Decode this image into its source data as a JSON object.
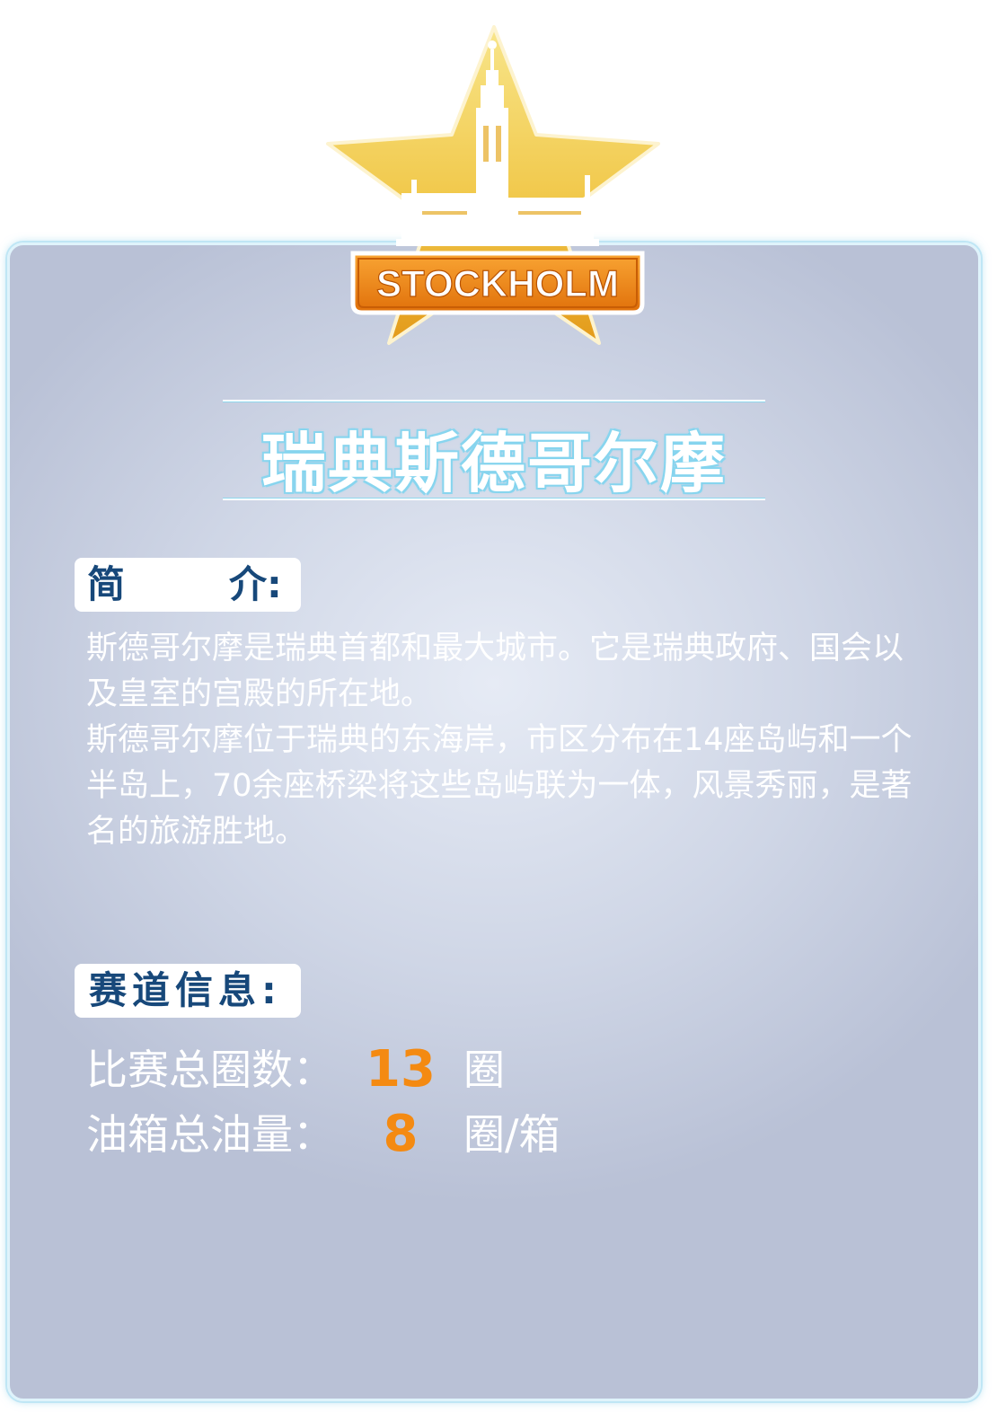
{
  "emblem": {
    "banner_text": "STOCKHOLM",
    "icon": "city-hall-star-icon",
    "colors": {
      "star_top": "#f7e07a",
      "star_bottom": "#e6a51e",
      "banner": "#f08a12"
    }
  },
  "title": "瑞典斯德哥尔摩",
  "intro": {
    "heading_char1": "简",
    "heading_char2": "介:",
    "paragraphs": [
      "斯德哥尔摩是瑞典首都和最大城市。它是瑞典政府、国会以及皇室的宫殿的所在地。",
      "斯德哥尔摩位于瑞典的东海岸，市区分布在14座岛屿和一个半岛上，70余座桥梁将这些岛屿联为一体，风景秀丽，是著名的旅游胜地。"
    ]
  },
  "track": {
    "heading": "赛道信息:",
    "laps_label": "比赛总圈数：",
    "laps_value": "13",
    "laps_unit": "圈",
    "fuel_label": "油箱总油量：",
    "fuel_value": "8",
    "fuel_unit": "圈/箱",
    "accent_color": "#f48a12"
  }
}
